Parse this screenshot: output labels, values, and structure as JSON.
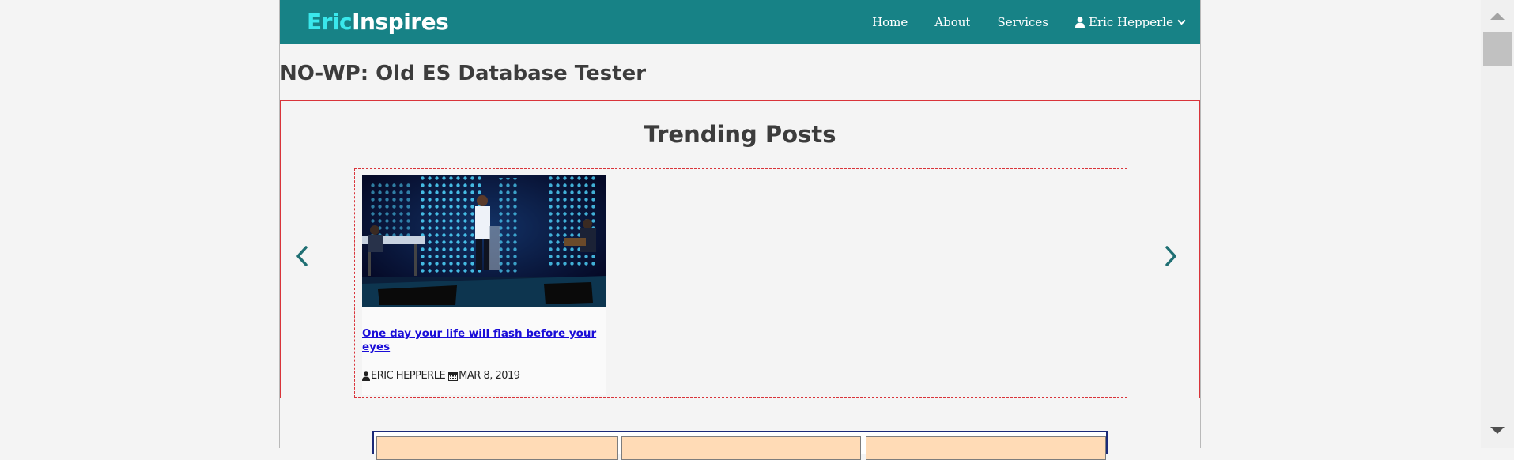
{
  "navbar": {
    "brand_part1": "Eric",
    "brand_part2": "Inspires",
    "links": [
      {
        "label": "Home"
      },
      {
        "label": "About"
      },
      {
        "label": "Services"
      },
      {
        "label": "Eric Hepperle",
        "icon": "user-icon",
        "caret_icon": "chevron-down-icon"
      }
    ]
  },
  "page_title": "NO-WP: Old ES Database Tester",
  "trending": {
    "heading": "Trending Posts",
    "prev_icon": "chevron-left-icon",
    "next_icon": "chevron-right-icon",
    "posts": [
      {
        "title": "One day your life will flash before your eyes",
        "author": "ERIC HEPPERLE",
        "date": "MAR 8, 2019",
        "author_icon": "user-icon",
        "date_icon": "calendar-icon"
      }
    ]
  },
  "colors": {
    "navbar_bg": "#178286",
    "brand_accent": "#3ae8ec",
    "link": "#1a0dd8",
    "section_border": "#d9343a",
    "table_cell": "#ffdbb6"
  }
}
